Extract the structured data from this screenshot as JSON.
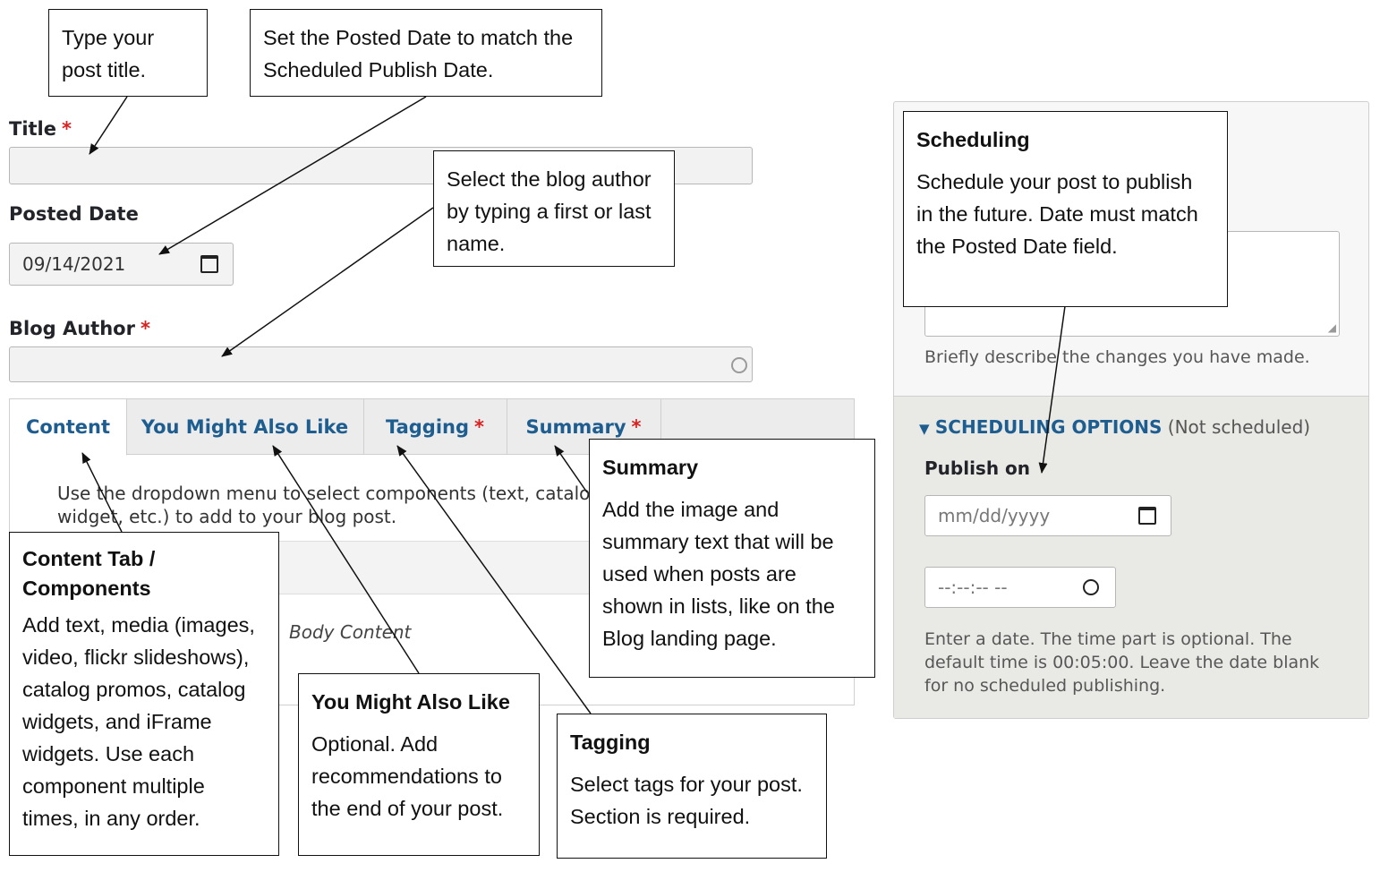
{
  "form": {
    "title_label": "Title",
    "required_mark": "*",
    "posted_date_label": "Posted Date",
    "posted_date_value": "09/14/2021",
    "blog_author_label": "Blog Author"
  },
  "tabs": [
    {
      "label": "Content",
      "active": true,
      "required": false
    },
    {
      "label": "You Might Also Like",
      "active": false,
      "required": false
    },
    {
      "label": "Tagging",
      "active": false,
      "required": true
    },
    {
      "label": "Summary",
      "active": false,
      "required": true
    }
  ],
  "content_tab": {
    "description": "Use the dropdown menu to select components (text, catalog widget, etc.) to add to your blog post.",
    "body_content_label": "Body Content"
  },
  "revision": {
    "help": "Briefly describe the changes you have made."
  },
  "scheduling": {
    "header": "SCHEDULING OPTIONS",
    "status": "(Not scheduled)",
    "publish_on_label": "Publish on",
    "date_placeholder": "mm/dd/yyyy",
    "time_placeholder": "--:--:-- --",
    "help": "Enter a date. The time part is optional. The default time is 00:05:00. Leave the date blank for no scheduled publishing."
  },
  "callouts": {
    "title": {
      "body": "Type your post title."
    },
    "posted_date": {
      "body": "Set the Posted Date to match the Scheduled Publish Date."
    },
    "author": {
      "body": "Select the blog author by typing a first or last name."
    },
    "content": {
      "heading": "Content Tab / Components",
      "body": "Add text, media (images, video, flickr slideshows), catalog promos, catalog widgets, and iFrame widgets. Use each component multiple times, in any order."
    },
    "ymal": {
      "heading": "You Might Also Like",
      "body": "Optional. Add recommendations to the end of your post."
    },
    "tagging": {
      "heading": "Tagging",
      "body": "Select tags for your post. Section is required."
    },
    "summary": {
      "heading": "Summary",
      "body": "Add the image and summary text that will be used when posts are shown in lists, like on the Blog landing page."
    },
    "scheduling": {
      "heading": "Scheduling",
      "body": "Schedule your post to publish in the future. Date must match the Posted Date field."
    }
  },
  "colors": {
    "link": "#1d5d90",
    "required": "#d72222",
    "panel": "#e9e9e6"
  }
}
